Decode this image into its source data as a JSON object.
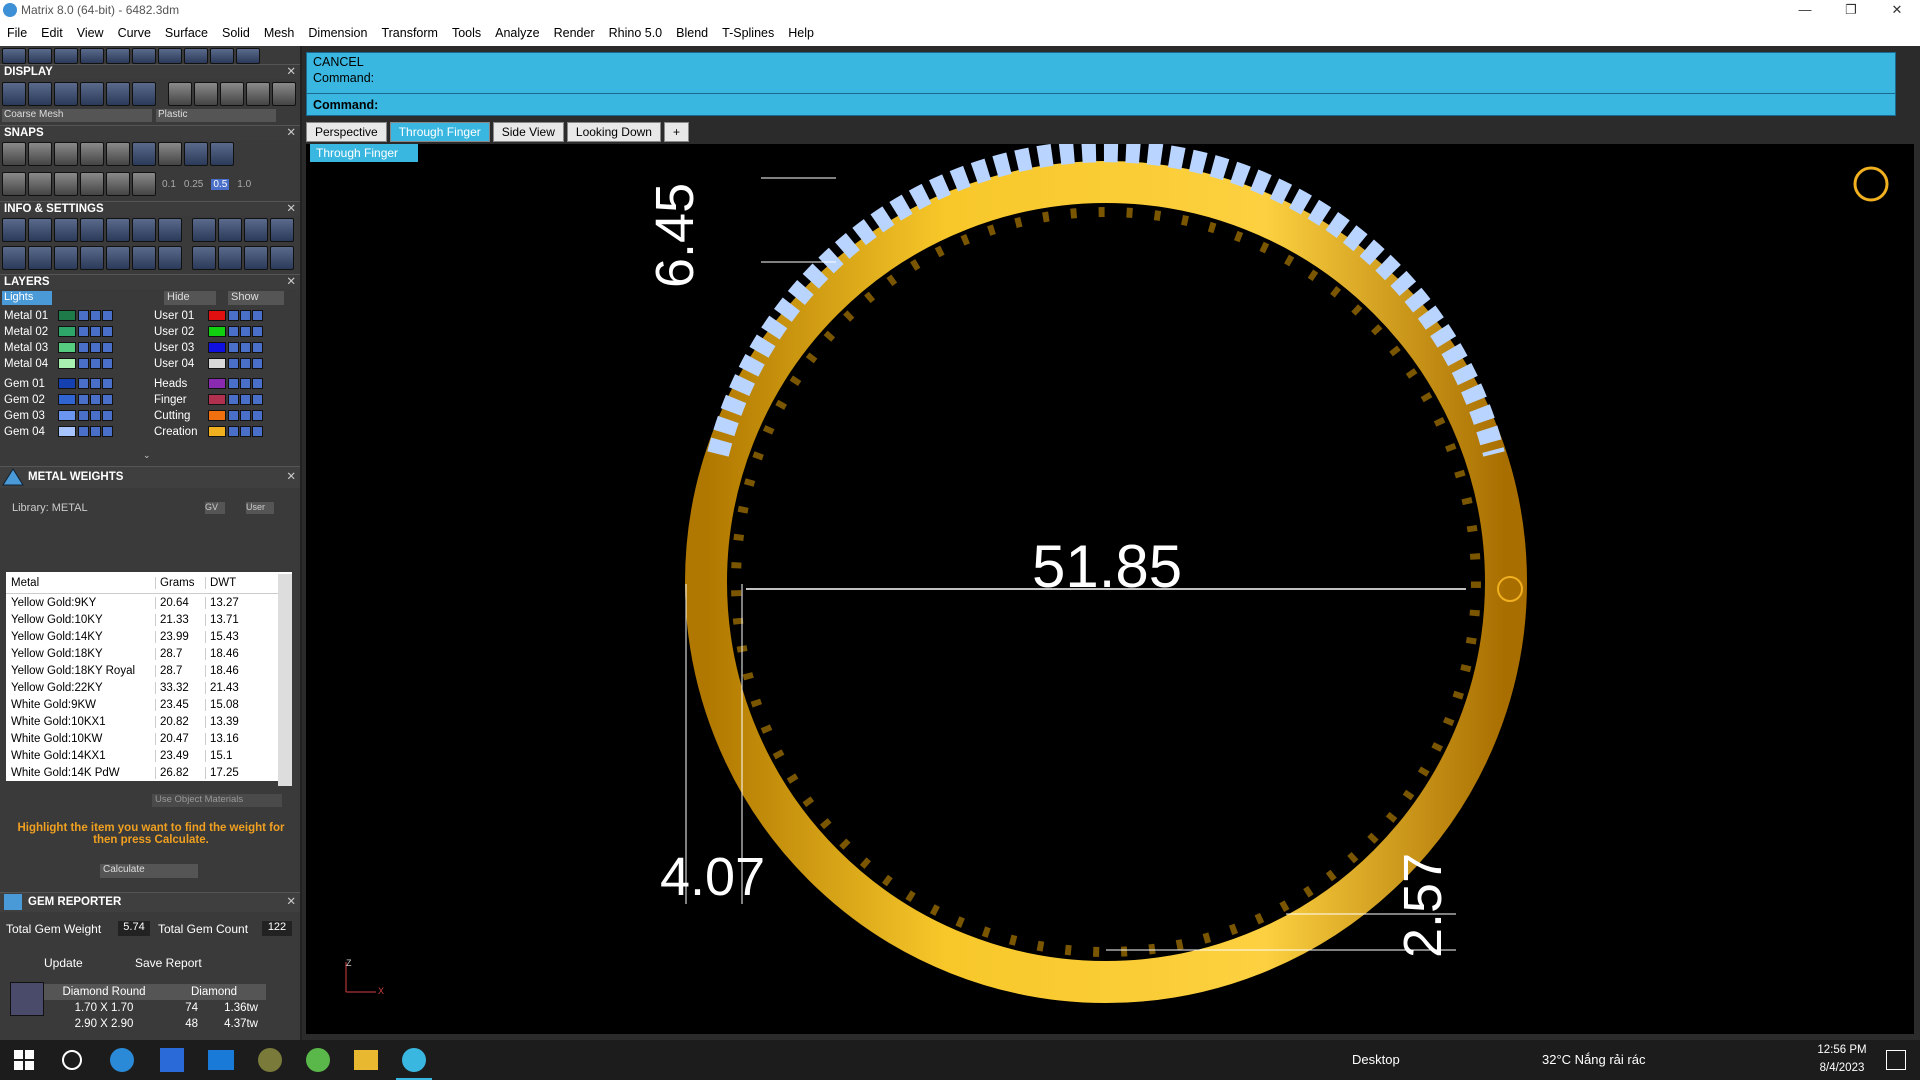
{
  "window": {
    "title": "Matrix 8.0 (64-bit) - 6482.3dm",
    "controls": [
      "—",
      "❐",
      "✕"
    ]
  },
  "menu": [
    "File",
    "Edit",
    "View",
    "Curve",
    "Surface",
    "Solid",
    "Mesh",
    "Dimension",
    "Transform",
    "Tools",
    "Analyze",
    "Render",
    "Rhino 5.0",
    "Blend",
    "T-Splines",
    "Help"
  ],
  "display": {
    "title": "DISPLAY",
    "mesh_select": "Coarse Mesh",
    "material_select": "Plastic"
  },
  "snaps": {
    "title": "SNAPS",
    "values": [
      "0.1",
      "0.25",
      "0.5",
      "1.0"
    ]
  },
  "info": {
    "title": "INFO & SETTINGS"
  },
  "layers": {
    "title": "LAYERS",
    "lights": "Lights",
    "hide": "Hide",
    "show": "Show",
    "left": [
      {
        "name": "Metal 01",
        "color": "#1f7a4a"
      },
      {
        "name": "Metal 02",
        "color": "#2ea66a"
      },
      {
        "name": "Metal 03",
        "color": "#55cc80"
      },
      {
        "name": "Metal 04",
        "color": "#a8f0b0"
      },
      {
        "name": "Gem 01",
        "color": "#1540b0"
      },
      {
        "name": "Gem 02",
        "color": "#3064d0"
      },
      {
        "name": "Gem 03",
        "color": "#6a96f0"
      },
      {
        "name": "Gem 04",
        "color": "#a8c4ff"
      }
    ],
    "right": [
      {
        "name": "User 01",
        "color": "#e01010"
      },
      {
        "name": "User 02",
        "color": "#10d010"
      },
      {
        "name": "User 03",
        "color": "#1010e0"
      },
      {
        "name": "User 04",
        "color": "#d8d8d8"
      },
      {
        "name": "Heads",
        "color": "#8a2ab0"
      },
      {
        "name": "Finger",
        "color": "#b03050"
      },
      {
        "name": "Cutting",
        "color": "#f07010"
      },
      {
        "name": "Creation",
        "color": "#f0b020"
      }
    ]
  },
  "metal_weights": {
    "title": "METAL WEIGHTS",
    "library": "Library: METAL",
    "gv": "GV",
    "user": "User",
    "columns": [
      "Metal",
      "Grams",
      "DWT"
    ],
    "rows": [
      [
        "Yellow Gold:9KY",
        "20.64",
        "13.27"
      ],
      [
        "Yellow Gold:10KY",
        "21.33",
        "13.71"
      ],
      [
        "Yellow Gold:14KY",
        "23.99",
        "15.43"
      ],
      [
        "Yellow Gold:18KY",
        "28.7",
        "18.46"
      ],
      [
        "Yellow Gold:18KY Royal",
        "28.7",
        "18.46"
      ],
      [
        "Yellow Gold:22KY",
        "33.32",
        "21.43"
      ],
      [
        "White Gold:9KW",
        "23.45",
        "15.08"
      ],
      [
        "White Gold:10KX1",
        "20.82",
        "13.39"
      ],
      [
        "White Gold:10KW",
        "20.47",
        "13.16"
      ],
      [
        "White Gold:14KX1",
        "23.49",
        "15.1"
      ],
      [
        "White Gold:14K PdW",
        "26.82",
        "17.25"
      ]
    ],
    "use_object_materials": "Use Object Materials",
    "hint": "Highlight the item you want to find the weight for then press Calculate.",
    "calculate": "Calculate"
  },
  "gem_reporter": {
    "title": "GEM REPORTER",
    "total_weight_label": "Total Gem Weight",
    "total_weight": "5.74",
    "total_count_label": "Total Gem Count",
    "total_count": "122",
    "update": "Update",
    "save_report": "Save Report",
    "head": [
      "Diamond Round",
      "Diamond"
    ],
    "rows": [
      [
        "1.70 X 1.70",
        "74",
        "1.36tw"
      ],
      [
        "2.90 X 2.90",
        "48",
        "4.37tw"
      ]
    ]
  },
  "command": {
    "line1": "CANCEL",
    "line2": "Command:",
    "prompt": "Command:"
  },
  "tabs": [
    "Perspective",
    "Through Finger",
    "Side View",
    "Looking Down",
    "+"
  ],
  "active_tab": "Through Finger",
  "view_dropdown": "Through Finger",
  "dimensions": {
    "top": "6.45",
    "diameter": "51.85",
    "left_bottom": "4.07",
    "right_bottom": "2.57"
  },
  "axis": {
    "z": "Z",
    "x": "X"
  },
  "taskbar": {
    "desktop": "Desktop",
    "weather": "32°C  Nắng rải rác",
    "time": "12:56 PM",
    "date": "8/4/2023"
  }
}
